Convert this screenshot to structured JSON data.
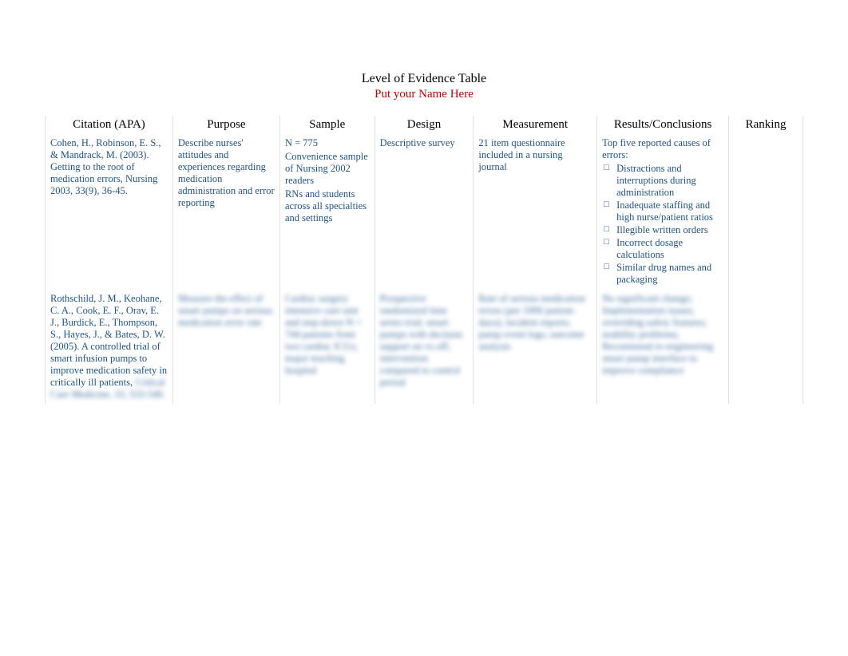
{
  "title": "Level of Evidence Table",
  "subtitle": "Put your Name Here",
  "headers": {
    "citation": "Citation (APA)",
    "purpose": "Purpose",
    "sample": "Sample",
    "design": "Design",
    "measurement": "Measurement",
    "results": "Results/Conclusions",
    "ranking": "Ranking"
  },
  "rows": [
    {
      "citation": "Cohen, H., Robinson, E. S., & Mandrack, M. (2003). Getting to the root of medication errors, Nursing 2003, 33(9), 36-45.",
      "purpose": "Describe nurses' attitudes and experiences regarding medication administration and error reporting",
      "sample_line1": "N = 775",
      "sample_line2": "Convenience sample of Nursing 2002 readers",
      "sample_line3": "RNs and students across all specialties and settings",
      "design": "Descriptive survey",
      "measurement": "21 item questionnaire included in a nursing journal",
      "results_intro": "Top five reported causes of errors:",
      "results_items": [
        "Distractions and interruptions during administration",
        "Inadequate staffing and high nurse/patient ratios",
        "Illegible written orders",
        "Incorrect dosage calculations",
        "Similar drug names and packaging"
      ],
      "ranking": ""
    },
    {
      "citation_visible": "Rothschild, J. M., Keohane, C. A., Cook, E. F., Orav, E. J., Burdick, E., Thompson, S., Hayes, J., & Bates, D. W.  (2005). A controlled trial of smart infusion pumps to improve medication safety in critically ill patients,",
      "citation_blur": "Critical Care Medicine, 33, 533-540.",
      "purpose_blur": "Measure the effect of smart pumps on serious medication error rate",
      "sample_blur": "Cardiac surgery intensive care unit and step-down N = 744 patients from two cardiac ICUs; major teaching hospital",
      "design_blur": "Prospective randomized time series trial; smart pumps with decision support on vs off; intervention compared to control period",
      "measurement_blur": "Rate of serious medication errors (per 1000 patient-days); incident reports; pump event logs; outcome analysis",
      "results_blur": "No significant change; Implementation issues; overriding safety features; usability problems; Recommend re-engineering smart pump interface to improve compliance",
      "ranking_blur": ""
    }
  ]
}
